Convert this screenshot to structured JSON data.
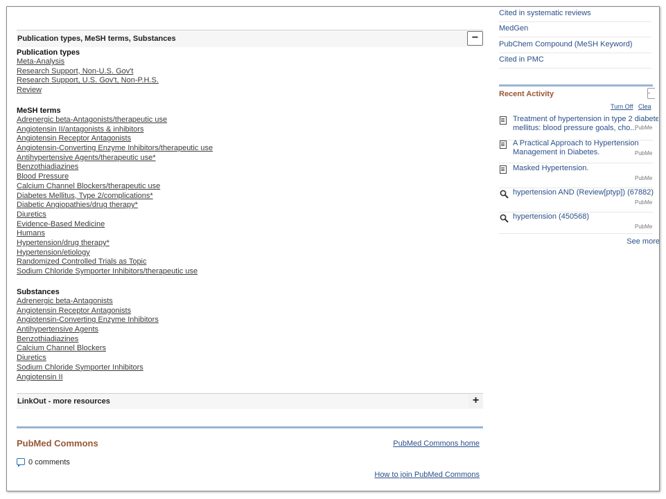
{
  "sidebar": {
    "links": [
      "Cited in systematic reviews",
      "MedGen",
      "PubChem Compound (MeSH Keyword)",
      "Cited in PMC"
    ],
    "recent_activity": {
      "title": "Recent Activity",
      "collapse_glyph": "-",
      "turn_off": "Turn Off",
      "clear": "Clea",
      "items": [
        {
          "icon": "document-icon",
          "text1": "Treatment of hypertension in type 2 diabete",
          "text2": "mellitus: blood pressure goals, cho...",
          "source": "PubMe"
        },
        {
          "icon": "document-icon",
          "text1": "A Practical Approach to Hypertension",
          "text2": "Management in Diabetes.",
          "source": "PubMe"
        },
        {
          "icon": "document-icon",
          "text1": "Masked Hypertension.",
          "text2": "",
          "source": "PubMe"
        },
        {
          "icon": "search-icon",
          "text1": "hypertension AND (Review[ptyp]) (67882)",
          "text2": "",
          "source": "PubMe"
        },
        {
          "icon": "search-icon",
          "text1": "hypertension (450568)",
          "text2": "",
          "source": "PubMe"
        }
      ],
      "see_more": "See more"
    }
  },
  "main": {
    "pubtypes_section": {
      "title": "Publication types, MeSH terms, Substances",
      "toggle": "−",
      "publication_types_heading": "Publication types",
      "publication_types": [
        "Meta-Analysis",
        "Research Support, Non-U.S. Gov't",
        "Research Support, U.S. Gov't, Non-P.H.S.",
        "Review"
      ],
      "mesh_heading": "MeSH terms",
      "mesh_terms": [
        "Adrenergic beta-Antagonists/therapeutic use",
        "Angiotensin II/antagonists & inhibitors",
        "Angiotensin Receptor Antagonists",
        "Angiotensin-Converting Enzyme Inhibitors/therapeutic use",
        "Antihypertensive Agents/therapeutic use*",
        "Benzothiadiazines",
        "Blood Pressure",
        "Calcium Channel Blockers/therapeutic use",
        "Diabetes Mellitus, Type 2/complications*",
        "Diabetic Angiopathies/drug therapy*",
        "Diuretics",
        "Evidence-Based Medicine",
        "Humans",
        "Hypertension/drug therapy*",
        "Hypertension/etiology",
        "Randomized Controlled Trials as Topic",
        "Sodium Chloride Symporter Inhibitors/therapeutic use"
      ],
      "substances_heading": "Substances",
      "substances": [
        "Adrenergic beta-Antagonists",
        "Angiotensin Receptor Antagonists",
        "Angiotensin-Converting Enzyme Inhibitors",
        "Antihypertensive Agents",
        "Benzothiadiazines",
        "Calcium Channel Blockers",
        "Diuretics",
        "Sodium Chloride Symporter Inhibitors",
        "Angiotensin II"
      ]
    },
    "linkout_section": {
      "title": "LinkOut - more resources",
      "toggle": "+"
    },
    "commons": {
      "title": "PubMed Commons",
      "home_link": "PubMed Commons home",
      "comments": "0 comments",
      "join_link": "How to join PubMed Commons"
    }
  }
}
